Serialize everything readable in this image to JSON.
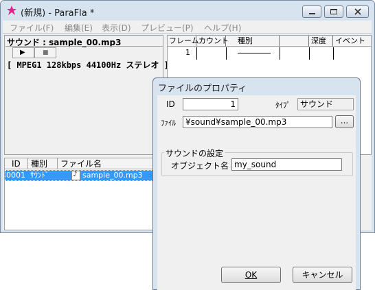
{
  "window": {
    "title": "(新規) - ParaFla *"
  },
  "menu": [
    "ファイル(F)",
    "編集(E)",
    "表示(D)",
    "プレビュー(P)",
    "ヘルプ(H)"
  ],
  "sound_panel": {
    "title": "サウンド : sample_00.mp3",
    "play_glyph": "▶",
    "stop_glyph": "■",
    "info": "[ MPEG1 128kbps 44100Hz ステレオ ]"
  },
  "timeline": {
    "columns": [
      "フレーム",
      "カウント",
      "種別",
      "深度",
      "イベント"
    ],
    "rows": [
      {
        "frame": "1"
      }
    ]
  },
  "asset_list": {
    "columns": [
      "ID",
      "種別",
      "ファイル名"
    ],
    "rows": [
      {
        "id": "0001",
        "type": "ｻｳﾝﾄﾞ",
        "file": "sample_00.mp3"
      }
    ]
  },
  "dialog": {
    "title": "ファイルのプロパティ",
    "id_label": "ID",
    "id_value": "1",
    "type_label": "ﾀｲﾌﾟ",
    "type_value": "サウンド",
    "file_label": "ﾌｧｲﾙ",
    "file_value": "¥sound¥sample_00.mp3",
    "browse_label": "...",
    "group_title": "サウンドの設定",
    "object_label": "オブジェクト名",
    "object_value": "my_sound",
    "ok_label": "OK",
    "cancel_label": "キャンセル"
  },
  "colors": {
    "selection": "#3399ff",
    "frame": "#d7e3ef",
    "face": "#f0f0f0"
  }
}
